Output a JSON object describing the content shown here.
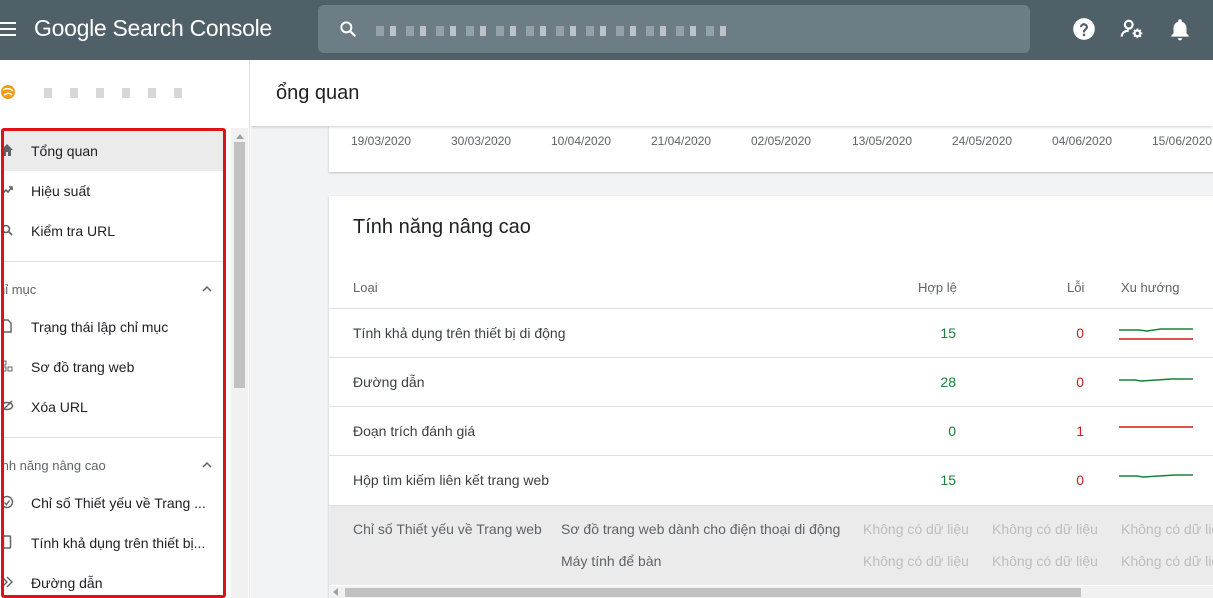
{
  "app": {
    "title": "Google Search Console"
  },
  "colors": {
    "topbar": "#4f6069",
    "valid": "#188038",
    "error": "#c5221f",
    "highlight": "#e0101a"
  },
  "sidebar": {
    "items": [
      {
        "label": "Tổng quan",
        "icon": "home-icon",
        "active": true
      },
      {
        "label": "Hiệu suất",
        "icon": "trending-up-icon"
      },
      {
        "label": "Kiểm tra URL",
        "icon": "search-icon"
      }
    ],
    "sections": [
      {
        "label": "hỉ mục",
        "items": [
          {
            "label": "Trạng thái lập chỉ mục",
            "icon": "file-icon"
          },
          {
            "label": "Sơ đồ trang web",
            "icon": "sitemap-icon"
          },
          {
            "label": "Xóa URL",
            "icon": "remove-eye-icon"
          }
        ]
      },
      {
        "label": "ính năng nâng cao",
        "items": [
          {
            "label": "Chỉ số Thiết yếu về Trang ...",
            "icon": "gauge-icon"
          },
          {
            "label": "Tính khả dụng trên thiết bị...",
            "icon": "phone-icon"
          },
          {
            "label": "Đường dẫn",
            "icon": "breadcrumb-icon"
          }
        ]
      }
    ]
  },
  "main": {
    "page_title": "ổng quan",
    "chart_dates": [
      "19/03/2020",
      "30/03/2020",
      "10/04/2020",
      "21/04/2020",
      "02/05/2020",
      "13/05/2020",
      "24/05/2020",
      "04/06/2020",
      "15/06/2020"
    ],
    "enhancements": {
      "title": "Tính năng nâng cao",
      "columns": {
        "type": "Loại",
        "valid": "Hợp lệ",
        "errors": "Lỗi",
        "trend": "Xu hướng"
      },
      "rows": [
        {
          "name": "Tính khả dụng trên thiết bị di động",
          "valid": "15",
          "errors": "0"
        },
        {
          "name": "Đường dẫn",
          "valid": "28",
          "errors": "0"
        },
        {
          "name": "Đoạn trích đánh giá",
          "valid": "0",
          "errors": "1"
        },
        {
          "name": "Hộp tìm kiếm liên kết trang web",
          "valid": "15",
          "errors": "0"
        }
      ],
      "cwv": {
        "title": "Chỉ số Thiết yếu về Trang web",
        "mobile": "Sơ đồ trang web dành cho điện thoại di động",
        "desktop": "Máy tính để bàn",
        "no_data": "Không có dữ liệu",
        "no_data_cut": "Không có dữ liệ"
      }
    }
  }
}
